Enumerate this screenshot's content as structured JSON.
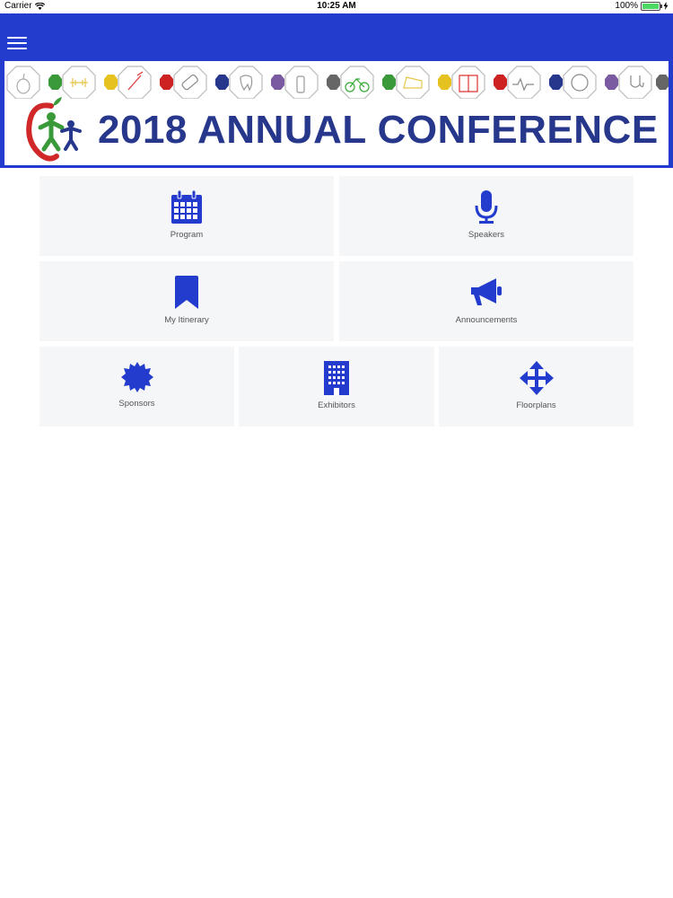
{
  "status_bar": {
    "carrier": "Carrier",
    "time": "10:25 AM",
    "battery": "100%"
  },
  "banner": {
    "title": "2018 ANNUAL CONFERENCE"
  },
  "colors": {
    "app_bar": "#233ccd",
    "icon_blue": "#233ccd",
    "tile_bg": "#f5f6f8",
    "title_blue": "#27388c"
  },
  "menu": {
    "tiles": [
      {
        "label": "Program",
        "icon": "calendar-icon"
      },
      {
        "label": "Speakers",
        "icon": "microphone-icon"
      },
      {
        "label": "My Itinerary",
        "icon": "bookmark-icon"
      },
      {
        "label": "Announcements",
        "icon": "megaphone-icon"
      },
      {
        "label": "Sponsors",
        "icon": "badge-icon"
      },
      {
        "label": "Exhibitors",
        "icon": "building-icon"
      },
      {
        "label": "Floorplans",
        "icon": "arrows-move-icon"
      }
    ]
  }
}
